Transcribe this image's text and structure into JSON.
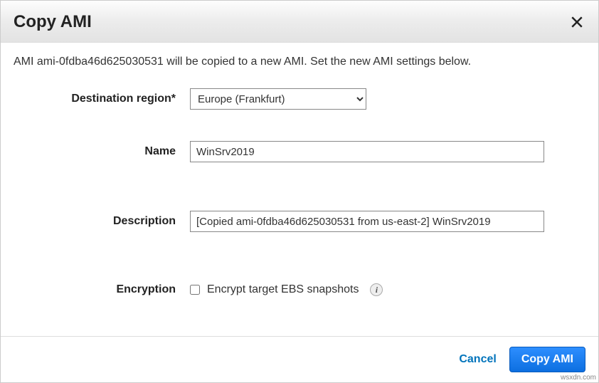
{
  "dialog": {
    "title": "Copy AMI",
    "intro": "AMI ami-0fdba46d625030531 will be copied to a new AMI. Set the new AMI settings below."
  },
  "form": {
    "region": {
      "label": "Destination region*",
      "value": "Europe (Frankfurt)"
    },
    "name": {
      "label": "Name",
      "value": "WinSrv2019"
    },
    "description": {
      "label": "Description",
      "value": "[Copied ami-0fdba46d625030531 from us-east-2] WinSrv2019"
    },
    "encryption": {
      "label": "Encryption",
      "checkbox_label": "Encrypt target EBS snapshots"
    }
  },
  "footer": {
    "cancel": "Cancel",
    "submit": "Copy AMI"
  },
  "watermark": "wsxdn.com"
}
